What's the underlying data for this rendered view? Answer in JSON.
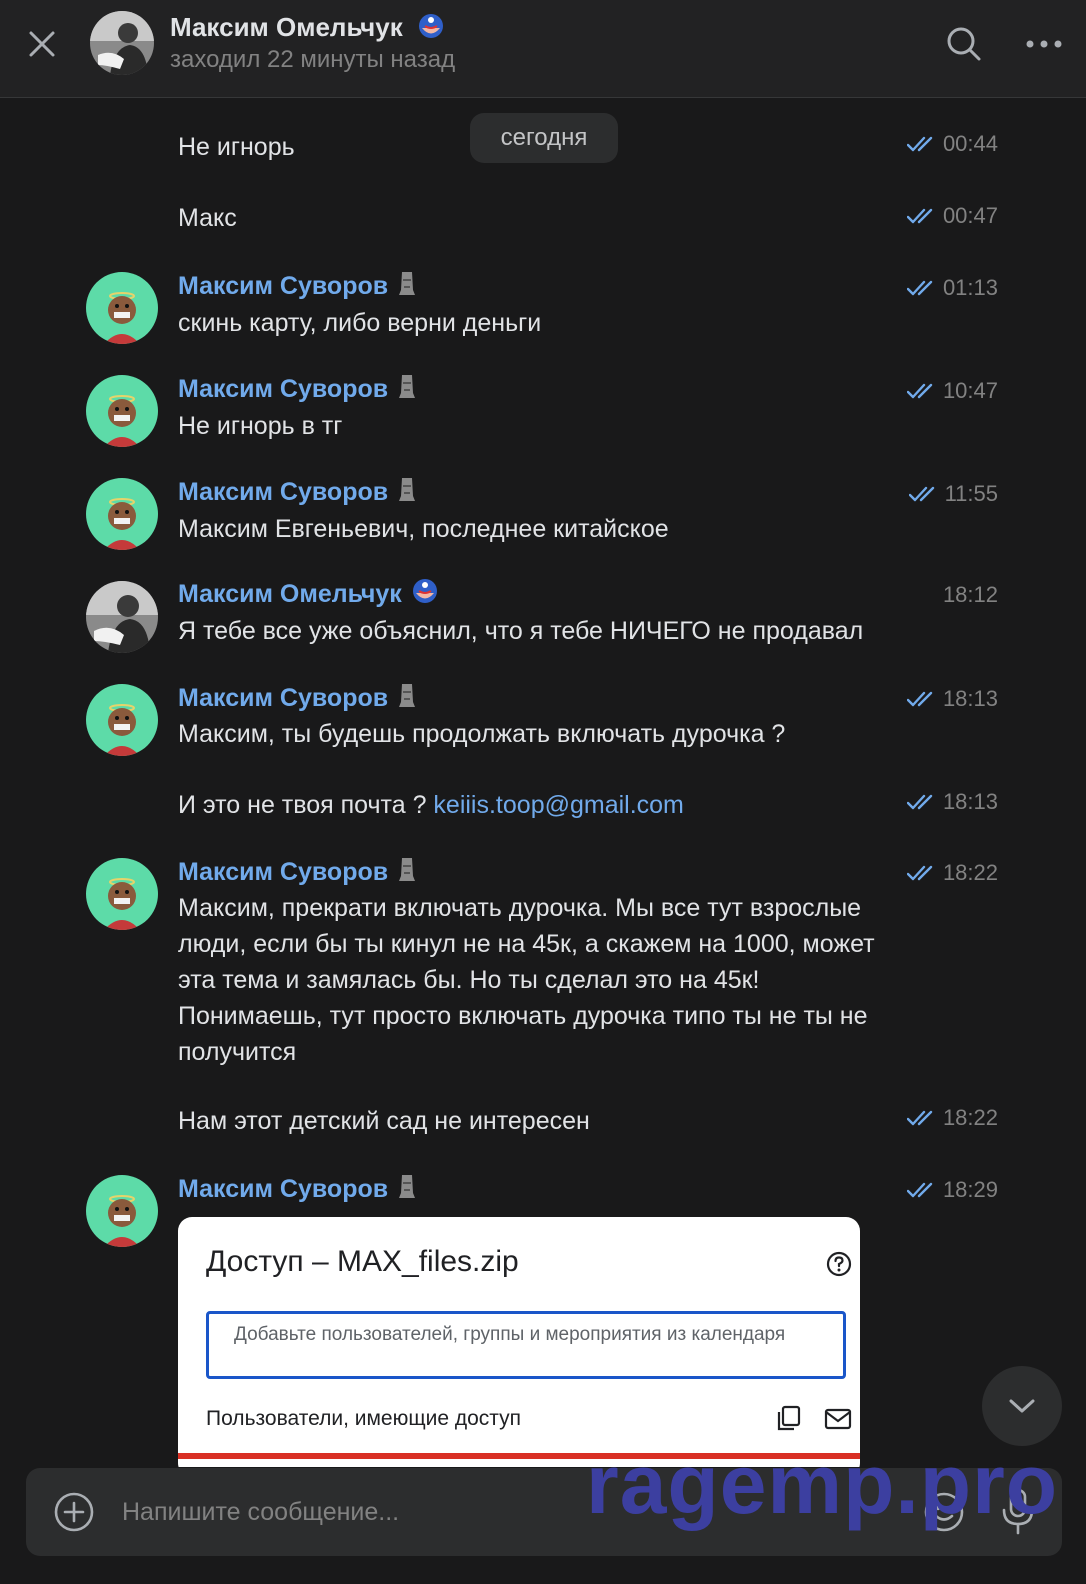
{
  "header": {
    "name": "Максим Омельчук",
    "status": "заходил 22 минуты назад",
    "avatar_icon": "profile-photo",
    "name_emoji_icon": "captain-america-mask-emoji"
  },
  "feed": {
    "date_divider": "сегодня",
    "messages": [
      {
        "sender": "",
        "text": "Не игнорь",
        "time": "00:44",
        "read": true
      },
      {
        "sender": "",
        "text": "Макс",
        "time": "00:47",
        "read": true
      },
      {
        "sender": "Максим Суворов",
        "text": "скинь карту, либо верни деньги",
        "time": "01:13",
        "read": true
      },
      {
        "sender": "Максим Суворов",
        "text": "Не игнорь в тг",
        "time": "10:47",
        "read": true
      },
      {
        "sender": "Максим Суворов",
        "text": "Максим Евгеньевич, последнее китайское",
        "time": "11:55",
        "read": true
      },
      {
        "sender": "Максим Омельчук",
        "text": "Я тебе все уже объяснил, что я тебе НИЧЕГО не продавал",
        "time": "18:12",
        "read": false
      },
      {
        "sender": "Максим Суворов",
        "text": "Максим, ты будешь продолжать включать дурочка ?",
        "time": "18:13",
        "read": true
      },
      {
        "sender": "",
        "text_prefix": "И это не твоя почта ? ",
        "link": "keiiis.toop@gmail.com",
        "time": "18:13",
        "read": true
      },
      {
        "sender": "Максим Суворов",
        "text": "Максим, прекрати включать дурочка. Мы все тут взрослые люди, если бы ты кинул не на 45к, а скажем на 1000, может эта тема и замялась бы. Но ты сделал это на 45к! Понимаешь, тут просто включать дурочка типо ты не ты не получится",
        "time": "18:22",
        "read": true
      },
      {
        "sender": "",
        "text": "Нам этот детский сад не интересен",
        "time": "18:22",
        "read": true
      },
      {
        "sender": "Максим Суворов",
        "text": "",
        "time": "18:29",
        "read": true
      }
    ],
    "sender_emoji_icon": "moai-emoji",
    "attachment": {
      "title": "Доступ – MAX_files.zip",
      "input_placeholder": "Добавьте пользователей, группы и мероприятия из календаря",
      "users_label": "Пользователи, имеющие доступ"
    }
  },
  "composer": {
    "placeholder": "Напишите сообщение..."
  },
  "watermark": "ragemp.pro",
  "colors": {
    "background": "#19191a",
    "header": "#222223",
    "accent": "#71aaeb",
    "muted": "#828282",
    "text": "#e1e3e6"
  }
}
